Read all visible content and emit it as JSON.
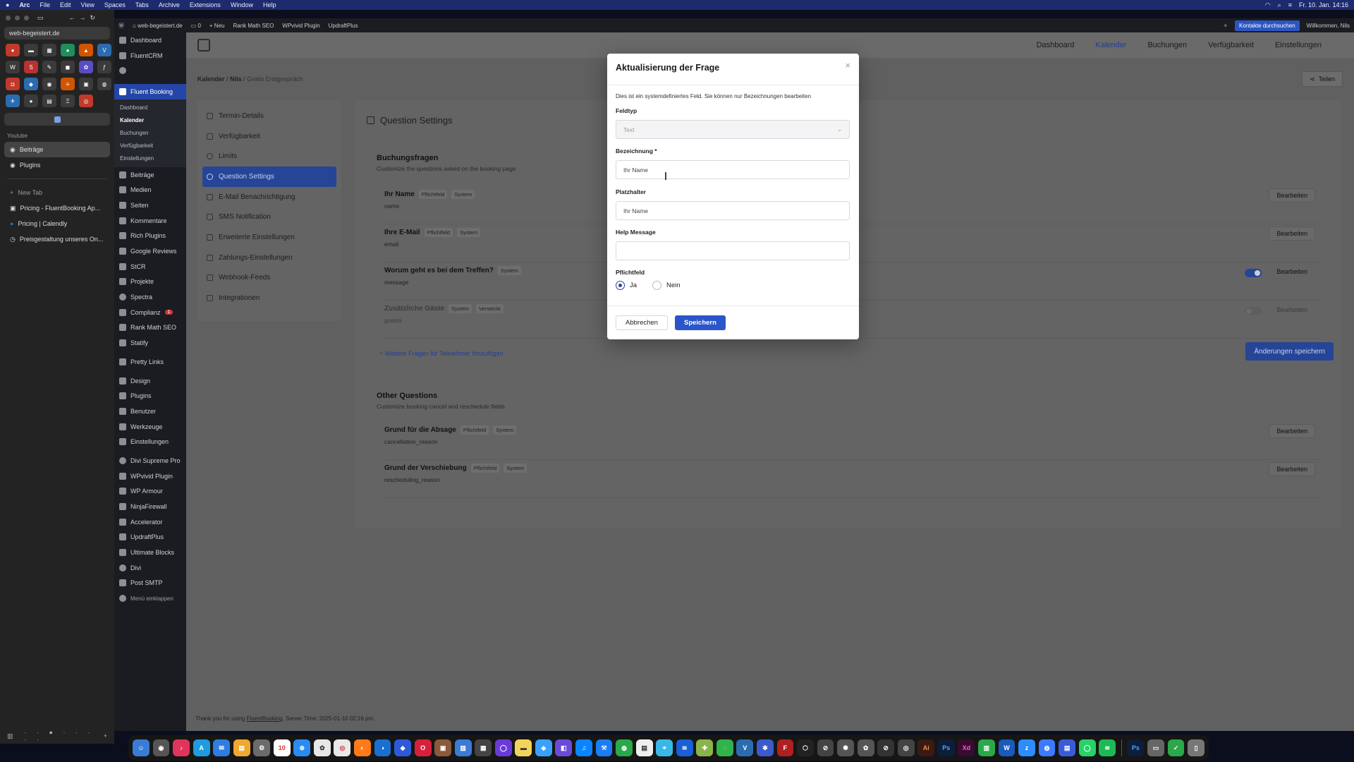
{
  "menubar": {
    "apple": "",
    "items": [
      "Arc",
      "File",
      "Edit",
      "View",
      "Spaces",
      "Tabs",
      "Archive",
      "Extensions",
      "Window",
      "Help"
    ],
    "clock": "Fr. 10. Jan. 14:16"
  },
  "arc": {
    "url": "web-begeistert.de",
    "section_label": "Youtube",
    "pinned_tabs": [
      "Beiträge",
      "Plugins"
    ],
    "new_tab": "New Tab",
    "tabs": [
      "Pricing - FluentBooking Ap...",
      "Pricing | Calendly",
      "Preisgestaltung unseres On..."
    ]
  },
  "adminbar": {
    "site": "web-begeistert.de",
    "comments": "0",
    "new": "Neu",
    "items": [
      "Rank Math SEO",
      "WPvivid Plugin",
      "UpdraftPlus"
    ],
    "search_btn": "Kontakte durchsuchen",
    "welcome": "Willkommen, Nils"
  },
  "wp_menu": {
    "top": [
      {
        "label": "Dashboard"
      },
      {
        "label": "FluentCRM"
      }
    ],
    "fluent_booking": "Fluent Booking",
    "fb_sub": [
      "Dashboard",
      "Kalender",
      "Buchungen",
      "Verfügbarkeit",
      "Einstellungen"
    ],
    "rest": [
      {
        "label": "Beiträge"
      },
      {
        "label": "Medien"
      },
      {
        "label": "Seiten"
      },
      {
        "label": "Kommentare"
      },
      {
        "label": "Rich Plugins"
      },
      {
        "label": "Google Reviews"
      },
      {
        "label": "StCR"
      },
      {
        "label": "Projekte"
      },
      {
        "label": "Spectra"
      },
      {
        "label": "Complianz"
      },
      {
        "label": "Rank Math SEO"
      },
      {
        "label": "Statify"
      },
      {
        "label": "Pretty Links"
      },
      {
        "label": "Design"
      },
      {
        "label": "Plugins"
      },
      {
        "label": "Benutzer"
      },
      {
        "label": "Werkzeuge"
      },
      {
        "label": "Einstellungen"
      },
      {
        "label": "Divi Supreme Pro"
      },
      {
        "label": "WPvivid Plugin"
      },
      {
        "label": "WP Armour"
      },
      {
        "label": "NinjaFirewall"
      },
      {
        "label": "Accelerator"
      },
      {
        "label": "UpdraftPlus"
      },
      {
        "label": "Ultimate Blocks"
      },
      {
        "label": "Divi"
      },
      {
        "label": "Post SMTP"
      },
      {
        "label": "Menü einklappen"
      }
    ],
    "complianz_count": "1"
  },
  "topnav": {
    "links": [
      "Dashboard",
      "Kalender",
      "Buchungen",
      "Verfügbarkeit",
      "Einstellungen"
    ]
  },
  "breadcrumb": {
    "a": "Kalender",
    "sep": "/",
    "b": "Nils",
    "c": "Gratis Erstgespräch"
  },
  "share": "Teilen",
  "settings_menu": [
    "Termin-Details",
    "Verfügbarkeit",
    "Limits",
    "Question Settings",
    "E-Mail Benachrichtigung",
    "SMS Notification",
    "Erweiterte Einstellungen",
    "Zahlungs-Einstellungen",
    "Webhook-Feeds",
    "Integrationen"
  ],
  "panel": {
    "title": "Question Settings",
    "booking_title": "Buchungsfragen",
    "booking_sub": "Customize the questions asked on the booking page",
    "questions": [
      {
        "label": "Ihr Name",
        "key": "name",
        "badges": [
          "Pflichtfeld",
          "System"
        ],
        "edit": "Bearbeiten"
      },
      {
        "label": "Ihre E-Mail",
        "key": "email",
        "badges": [
          "Pflichtfeld",
          "System"
        ],
        "edit": "Bearbeiten"
      },
      {
        "label": "Worum geht es bei dem Treffen?",
        "key": "message",
        "badges": [
          "System"
        ],
        "edit": "Bearbeiten"
      },
      {
        "label": "Zusätzliche Gäste",
        "key": "guests",
        "badges": [
          "System",
          "Versteckt"
        ],
        "edit": "Bearbeiten"
      }
    ],
    "add_link": "+ Weitere Fragen für Teilnehmer hinzufügen",
    "save_btn": "Änderungen speichern",
    "other_title": "Other Questions",
    "other_sub": "Customize booking cancel and reschedule fields",
    "other": [
      {
        "label": "Grund für die Absage",
        "key": "cancellation_reason",
        "badges": [
          "Pflichtfeld",
          "System"
        ],
        "edit": "Bearbeiten"
      },
      {
        "label": "Grund der Verschiebung",
        "key": "rescheduling_reason",
        "badges": [
          "Pflichtfeld",
          "System"
        ],
        "edit": "Bearbeiten"
      }
    ]
  },
  "footer": {
    "text": "Thank you for using",
    "link": "FluentBooking",
    "server": ". Server Time: 2025-01-10 02:16 pm"
  },
  "modal": {
    "title": "Aktualisierung der Frage",
    "close": "×",
    "note": "Dies ist ein systemdefiniertes Feld. Sie können nur Bezeichnungen bearbeiten",
    "field_type_label": "Feldtyp",
    "field_type_value": "Text",
    "label_label": "Bezeichnung *",
    "label_value": "Ihr Name",
    "placeholder_label": "Platzhalter",
    "placeholder_value": "Ihr Name",
    "help_label": "Help Message",
    "help_value": "",
    "required_label": "Pflichtfeld",
    "yes": "Ja",
    "no": "Nein",
    "cancel": "Abbrechen",
    "save": "Speichern"
  }
}
